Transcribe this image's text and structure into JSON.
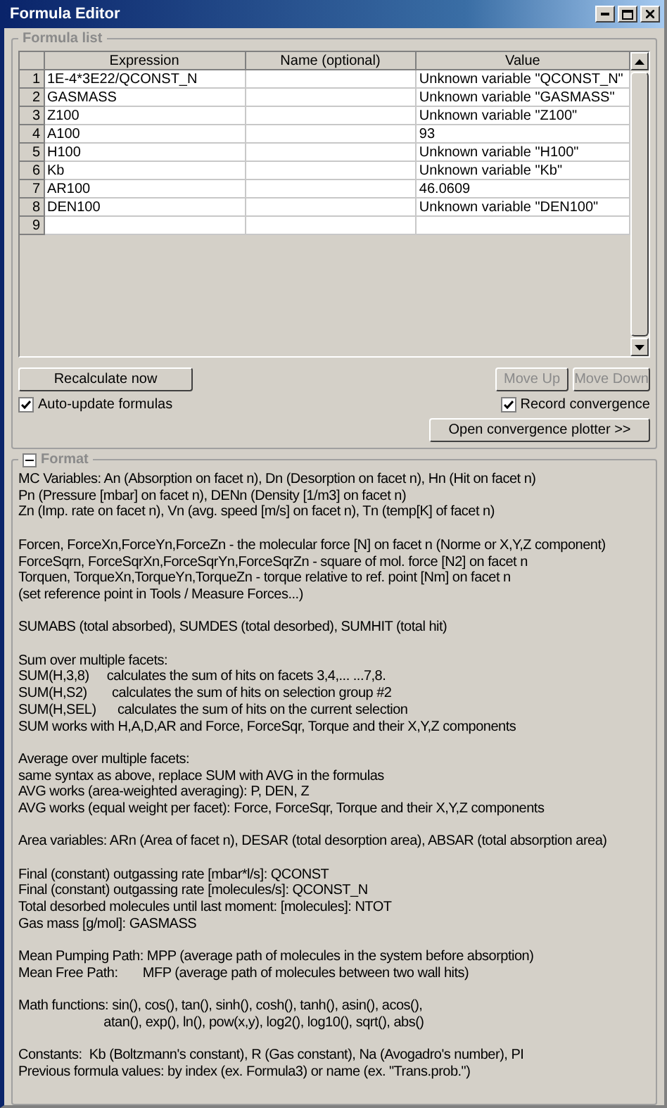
{
  "window": {
    "title": "Formula Editor"
  },
  "formula_list": {
    "title": "Formula list",
    "columns": [
      "Expression",
      "Name (optional)",
      "Value"
    ],
    "rows": [
      {
        "index": "1",
        "expression": "1E-4*3E22/QCONST_N",
        "value": "Unknown variable \"QCONST_N\""
      },
      {
        "index": "2",
        "expression": "GASMASS",
        "value": "Unknown variable \"GASMASS\""
      },
      {
        "index": "3",
        "expression": "Z100",
        "value": "Unknown variable \"Z100\""
      },
      {
        "index": "4",
        "expression": "A100",
        "value": "93"
      },
      {
        "index": "5",
        "expression": "H100",
        "value": "Unknown variable \"H100\""
      },
      {
        "index": "6",
        "expression": "Kb",
        "value": "Unknown variable \"Kb\""
      },
      {
        "index": "7",
        "expression": "AR100",
        "value": "46.0609"
      },
      {
        "index": "8",
        "expression": "DEN100",
        "value": "Unknown variable \"DEN100\""
      },
      {
        "index": "9"
      }
    ],
    "recalculate_button": "Recalculate now",
    "move_up_button": {
      "label": "Move Up",
      "disabled": true
    },
    "move_down_button": {
      "label": "Move Down",
      "disabled": true
    },
    "auto_update": {
      "label": "Auto-update formulas",
      "checked": true
    },
    "record_convergence": {
      "label": "Record convergence",
      "checked": true
    },
    "plotter_button": "Open convergence plotter >>"
  },
  "format": {
    "title": "Format",
    "expanded": true,
    "paragraphs": [
      [
        "MC Variables: An (Absorption on facet n), Dn (Desorption on facet n), Hn (Hit on facet n)",
        "Pn (Pressure [mbar] on facet n), DENn (Density [1/m3] on facet n)",
        "Zn (Imp. rate on facet n), Vn (avg. speed [m/s] on facet n), Tn (temp[K] of facet n)"
      ],
      [
        "Forcen, ForceXn,ForceYn,ForceZn - the molecular force [N] on facet n (Norme or X,Y,Z component)",
        "ForceSqrn, ForceSqrXn,ForceSqrYn,ForceSqrZn - square of mol. force [N2] on facet n",
        "Torquen, TorqueXn,TorqueYn,TorqueZn - torque relative to ref. point [Nm] on facet n",
        "(set reference point in Tools / Measure Forces...)"
      ],
      [
        "SUMABS (total absorbed), SUMDES (total desorbed), SUMHIT (total hit)"
      ],
      [
        "Sum over multiple facets:",
        "SUM(H,3,8)     calculates the sum of hits on facets 3,4,... ...7,8.",
        "SUM(H,S2)       calculates the sum of hits on selection group #2",
        "SUM(H,SEL)      calculates the sum of hits on the current selection",
        "SUM works with H,A,D,AR and Force, ForceSqr, Torque and their X,Y,Z components"
      ],
      [
        "Average over multiple facets:",
        "same syntax as above, replace SUM with AVG in the formulas",
        "AVG works (area-weighted averaging): P, DEN, Z",
        "AVG works (equal weight per facet): Force, ForceSqr, Torque and their X,Y,Z components"
      ],
      [
        "Area variables: ARn (Area of facet n), DESAR (total desorption area), ABSAR (total absorption area)"
      ],
      [
        "Final (constant) outgassing rate [mbar*l/s]: QCONST",
        "Final (constant) outgassing rate [molecules/s]: QCONST_N",
        "Total desorbed molecules until last moment: [molecules]: NTOT",
        "Gas mass [g/mol]: GASMASS"
      ],
      [
        "Mean Pumping Path: MPP (average path of molecules in the system before absorption)",
        "Mean Free Path:       MFP (average path of molecules between two wall hits)"
      ],
      [
        "Math functions: sin(), cos(), tan(), sinh(), cosh(), tanh(), asin(), acos(),",
        "                        atan(), exp(), ln(), pow(x,y), log2(), log10(), sqrt(), abs()"
      ],
      [
        "Constants:  Kb (Boltzmann's constant), R (Gas constant), Na (Avogadro's number), PI",
        "Previous formula values: by index (ex. Formula3) or name (ex. \"Trans.prob.\")"
      ]
    ]
  }
}
